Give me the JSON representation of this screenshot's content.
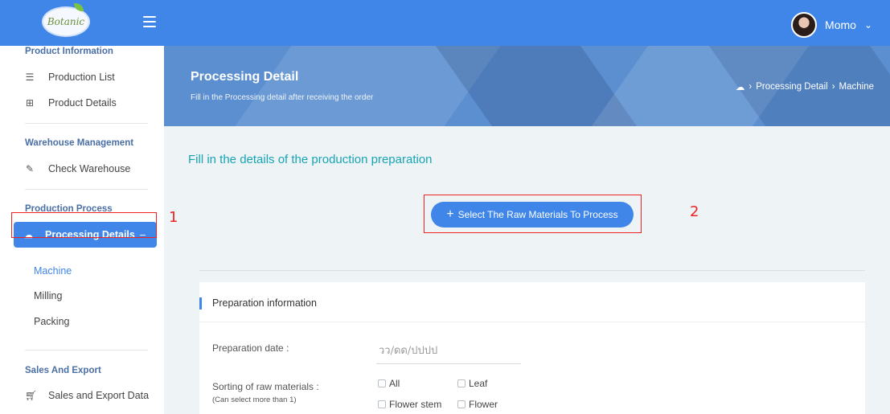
{
  "header": {
    "logo_text": "Botanic",
    "user_name": "Momo"
  },
  "sidebar": {
    "product_info_title": "Product Information",
    "production_list": "Production List",
    "product_details": "Product Details",
    "warehouse_title": "Warehouse Management",
    "check_warehouse": "Check Warehouse",
    "production_process_title": "Production Process",
    "processing_details": "Processing Details",
    "processing_collapse": "–",
    "sub_items": [
      "Machine",
      "Milling",
      "Packing"
    ],
    "sales_title": "Sales And Export",
    "sales_export_data": "Sales and Export Data"
  },
  "banner": {
    "title": "Processing Detail",
    "subtitle": "Fill in the Processing detail after receiving the order",
    "breadcrumb": [
      "Processing Detail",
      "Machine"
    ]
  },
  "main": {
    "title": "Fill in the details of the production preparation",
    "select_button": "Select The Raw Materials To Process",
    "annotation_1": "1",
    "annotation_2": "2"
  },
  "card": {
    "title": "Preparation information",
    "date_label": "Preparation date :",
    "date_placeholder": "วว/ดด/ปปปป",
    "sorting_label": "Sorting of raw materials :",
    "sorting_hint": "(Can select more than 1)",
    "options": [
      "All",
      "Leaf",
      "Flower stem",
      "Flower"
    ]
  },
  "colors": {
    "primary": "#3f86e8",
    "title_teal": "#18a4b4",
    "annotation_red": "#e22"
  }
}
